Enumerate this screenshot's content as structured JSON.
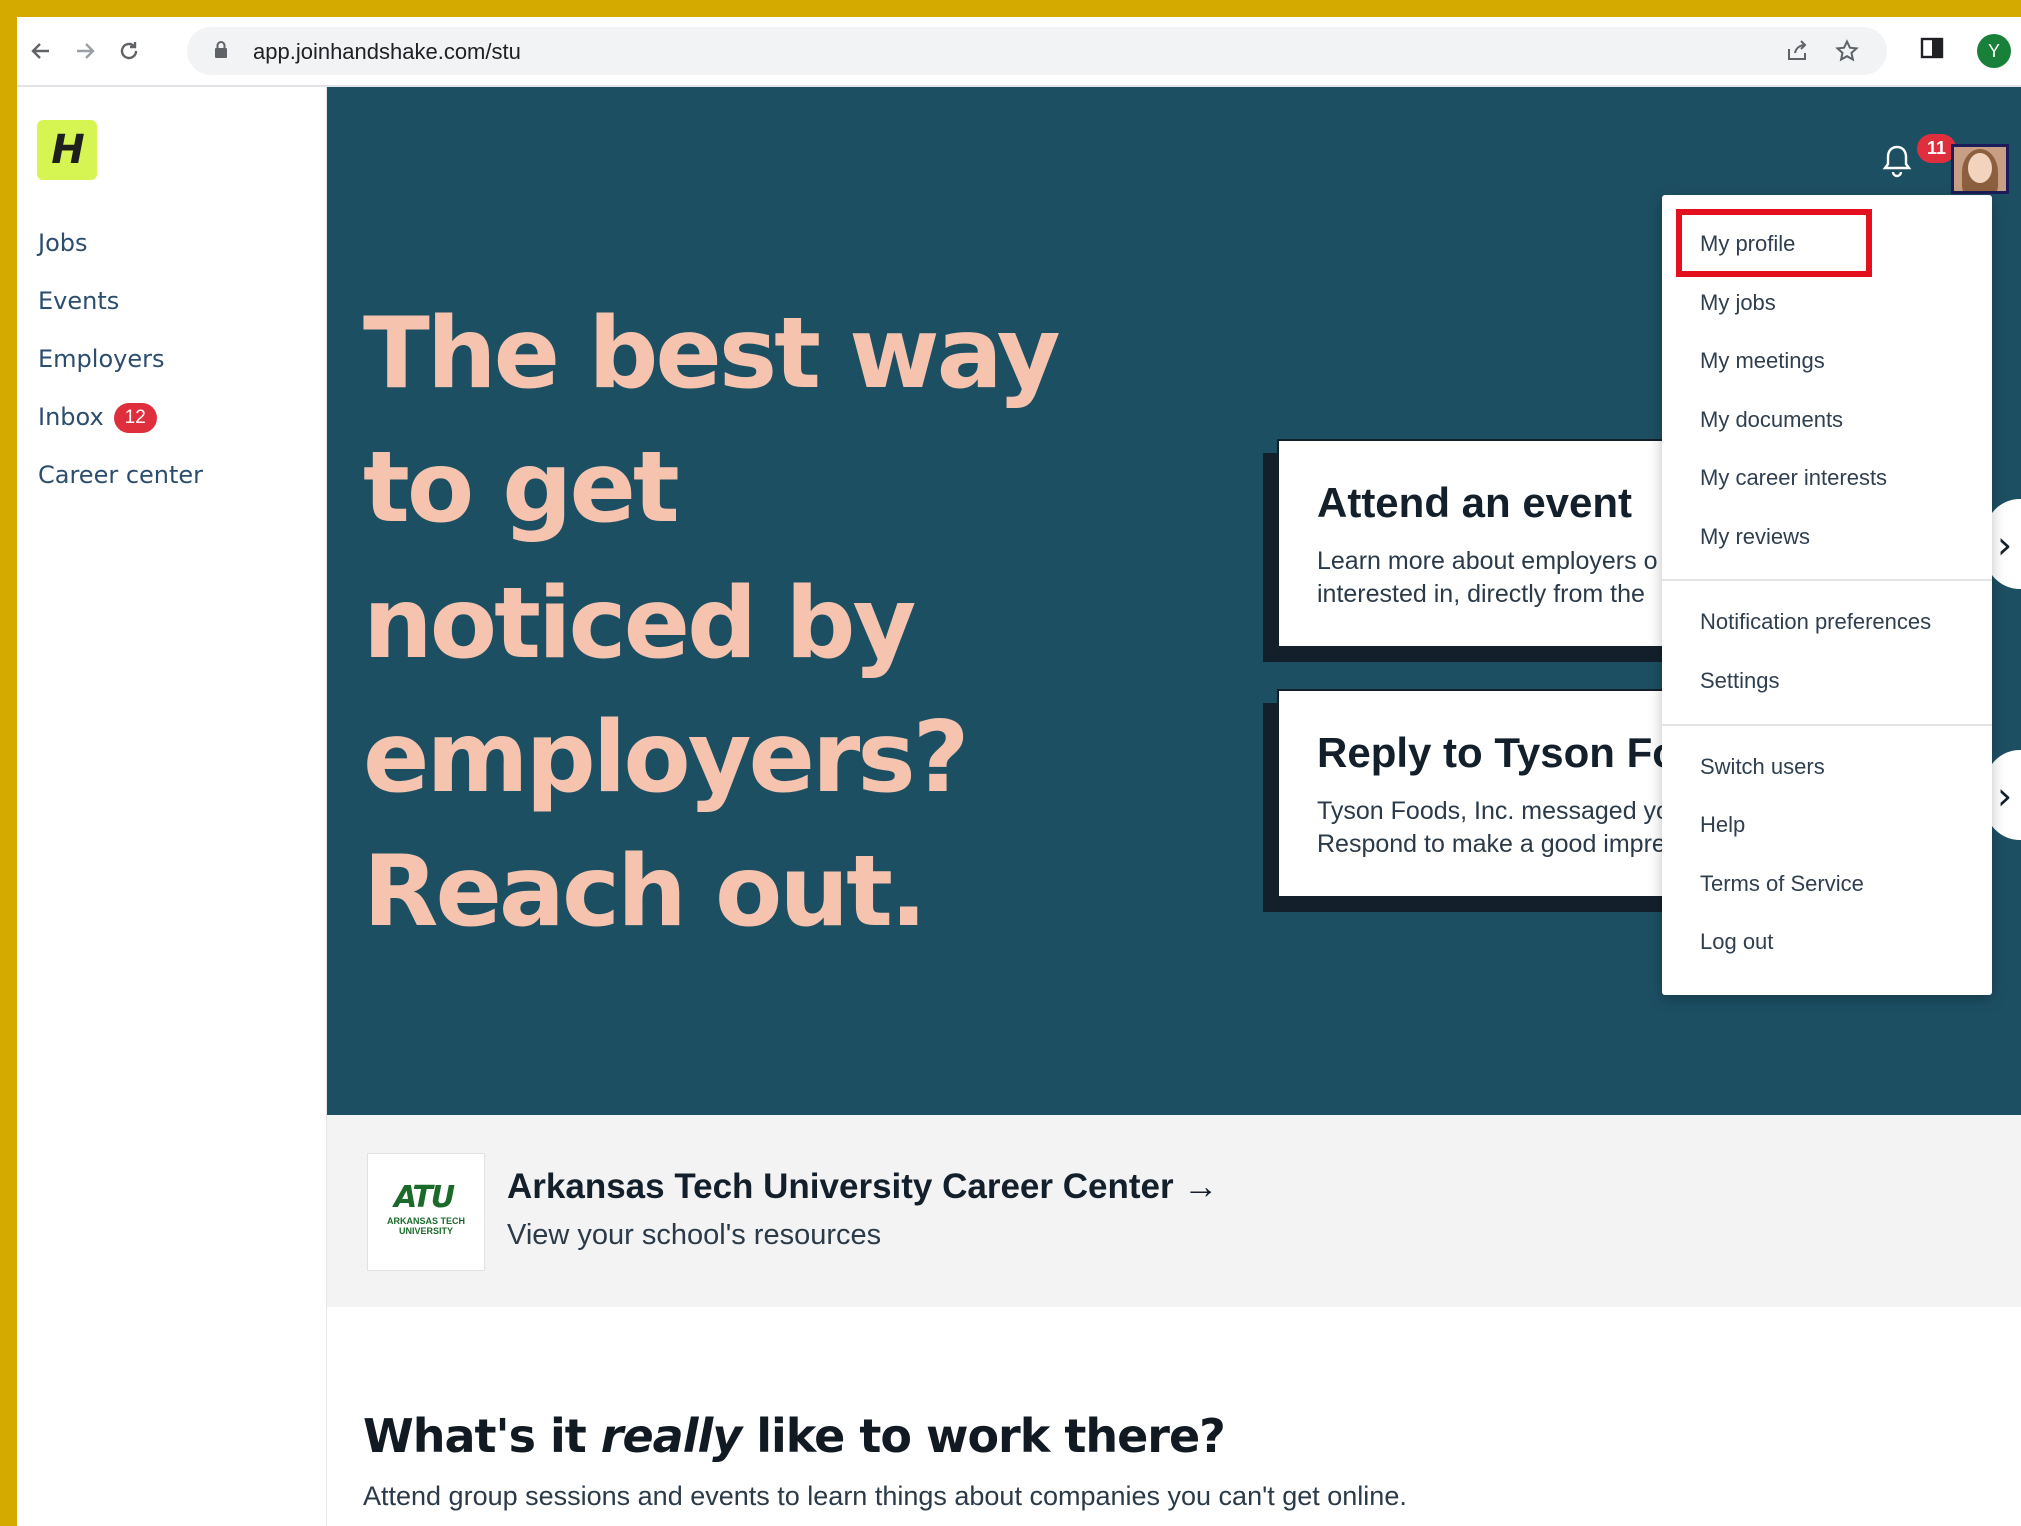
{
  "browser": {
    "url": "app.joinhandshake.com/stu",
    "profile_initial": "Y"
  },
  "sidebar": {
    "logo_text": "H",
    "items": [
      {
        "label": "Jobs"
      },
      {
        "label": "Events"
      },
      {
        "label": "Employers"
      },
      {
        "label": "Inbox",
        "badge": "12"
      },
      {
        "label": "Career center"
      }
    ]
  },
  "hero": {
    "headline_lines": [
      "The best way",
      "to get",
      "noticed by",
      "employers?",
      "Reach out."
    ],
    "cards": [
      {
        "title": "Attend an event",
        "desc_line1": "Learn more about employers o",
        "desc_line2": "interested in, directly from the"
      },
      {
        "title": "Reply to Tyson Fo",
        "desc_line1": "Tyson Foods, Inc. messaged yo",
        "desc_line2": "Respond to make a good impre"
      }
    ],
    "notification_count": "11"
  },
  "dropdown": {
    "items": [
      "My profile",
      "My jobs",
      "My meetings",
      "My documents",
      "My career interests",
      "My reviews",
      "Notification preferences",
      "Settings",
      "Switch users",
      "Help",
      "Terms of Service",
      "Log out"
    ]
  },
  "career_center": {
    "logo_big": "ATU",
    "logo_small": "ARKANSAS TECH UNIVERSITY",
    "title": "Arkansas Tech University Career Center →",
    "subtitle": "View your school's resources"
  },
  "section": {
    "title_before": "What's it ",
    "title_em": "really",
    "title_after": " like to work there?",
    "subtitle": "Attend group sessions and events to learn things about companies you can't get online."
  },
  "colors": {
    "hero_bg": "#1d4f63",
    "hero_text": "#f5c3ae",
    "logo_bg": "#d6f552",
    "badge_red": "#e02f3c",
    "highlight_red": "#e5101f",
    "frame": "#d4a900"
  }
}
